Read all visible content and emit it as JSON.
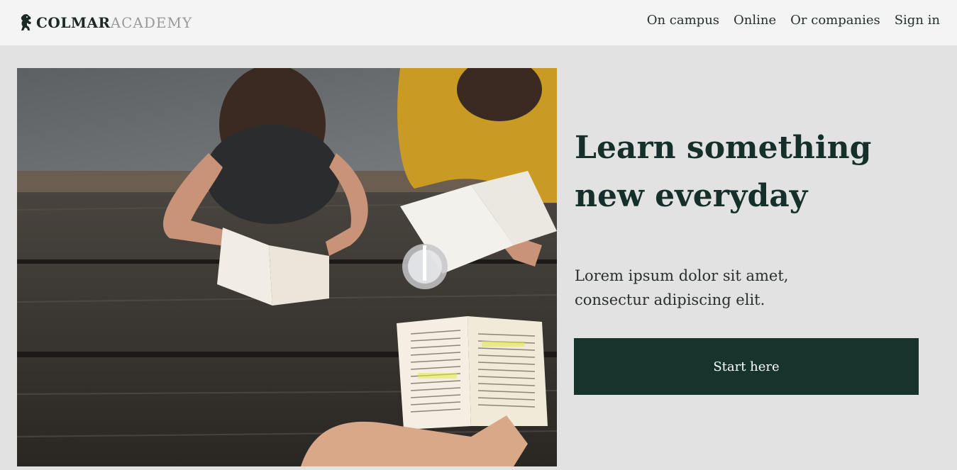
{
  "brand": {
    "name_strong": "COLMAR",
    "name_light": "ACADEMY",
    "icon": "lion-rampant-icon"
  },
  "nav": {
    "items": [
      {
        "label": "On campus"
      },
      {
        "label": "Online"
      },
      {
        "label": "Or companies"
      },
      {
        "label": "Sign in"
      }
    ]
  },
  "hero": {
    "image": "students-reading-at-picnic-table",
    "headline": "Learn something new everyday",
    "subtext": "Lorem ipsum dolor sit amet, consectur adipiscing elit.",
    "cta_label": "Start here"
  },
  "colors": {
    "page_bg": "#e2e2e2",
    "header_bg": "#f4f4f4",
    "accent": "#17342c",
    "brand_light": "#9a9a9a"
  }
}
